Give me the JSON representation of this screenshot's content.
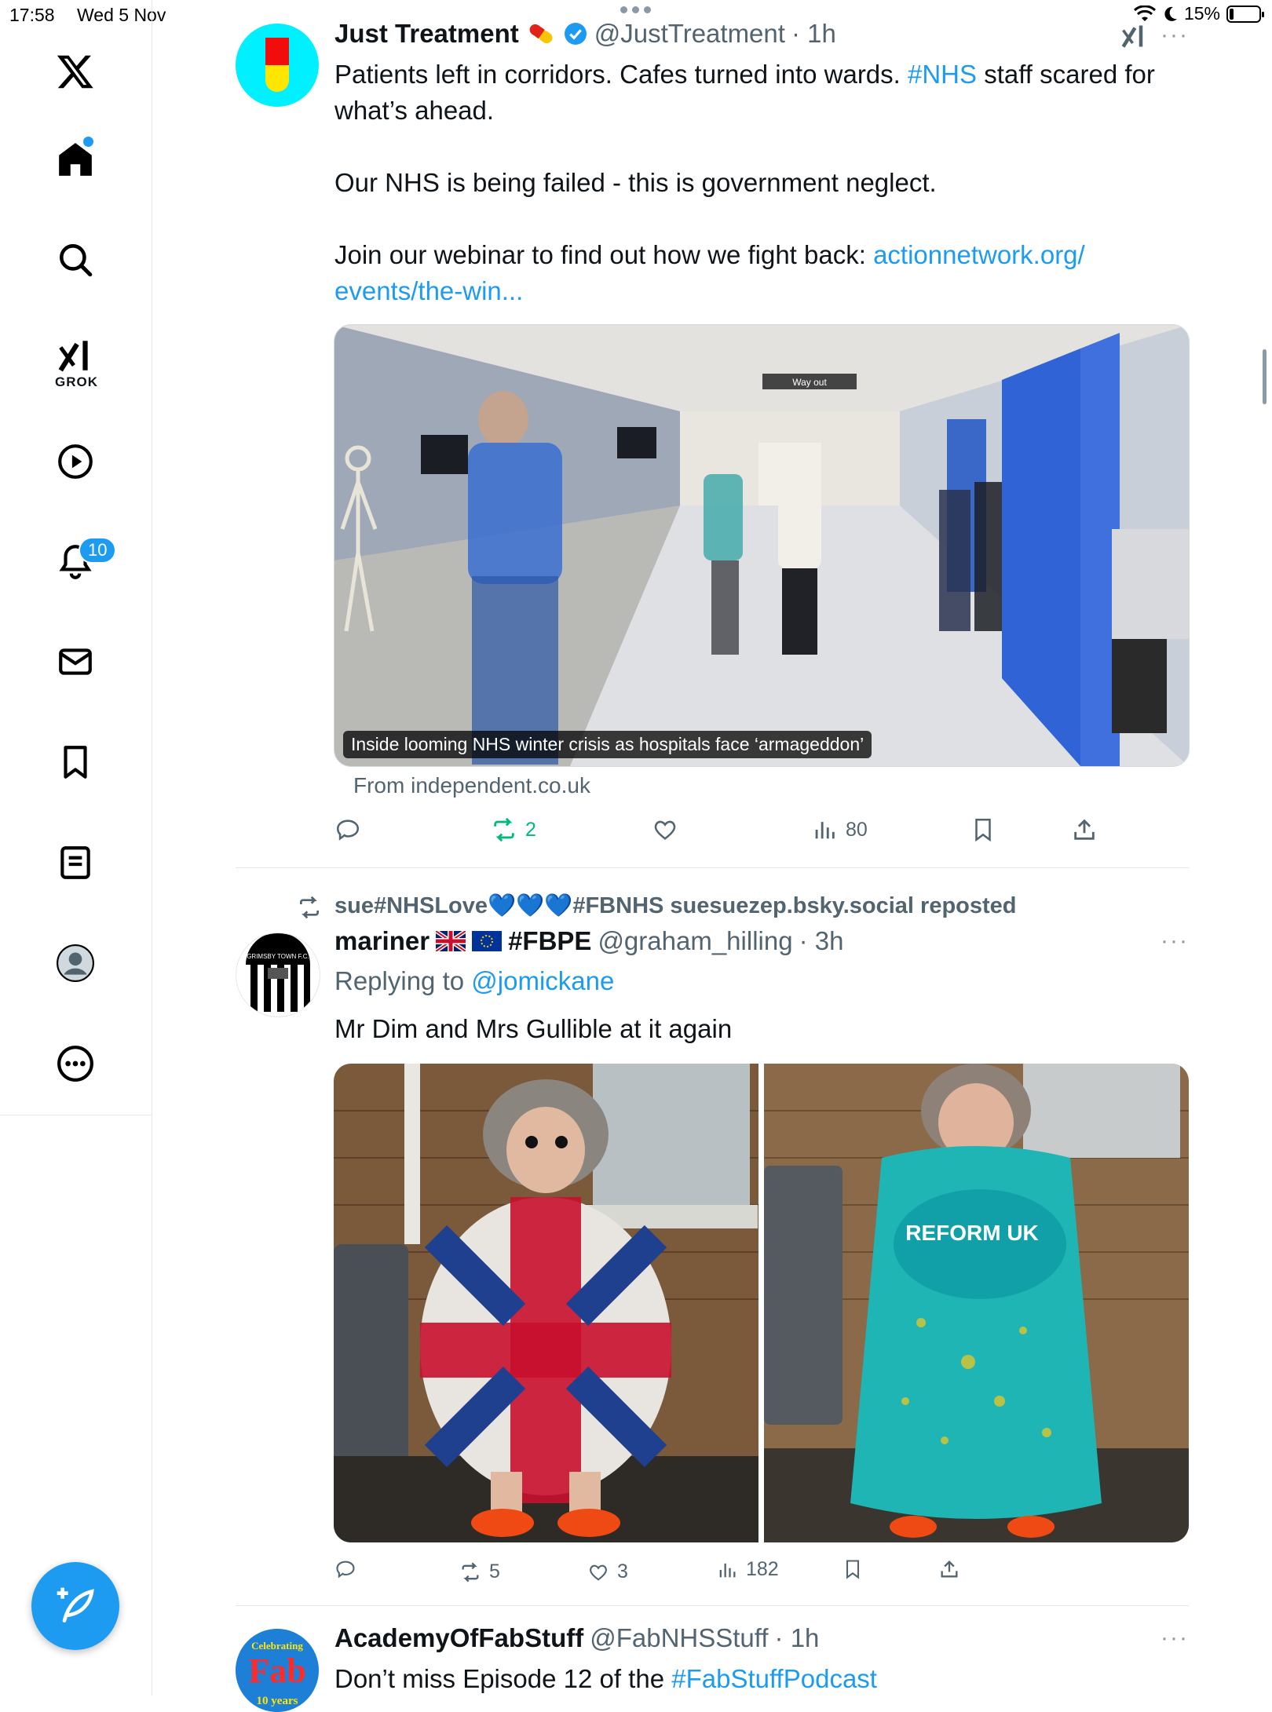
{
  "status_bar": {
    "time": "17:58",
    "date": "Wed 5 Nov",
    "battery": "15%",
    "battery_level": 0.15
  },
  "sidebar": {
    "grok_label": "GROK",
    "notifications_count": "10"
  },
  "tweet1": {
    "name": "Just Treatment",
    "handle": "@JustTreatment",
    "time": "· 1h",
    "text_part1": "Patients left in corridors. Cafes turned into wards. ",
    "hashtag": "#NHS",
    "text_part2": " staff scared for what’s ahead.",
    "text_para2": "Our NHS is being failed - this is government neglect.",
    "text_para3": "Join our webinar to find out how we fight back: ",
    "link": "actionnetwork.org/ events/the-win...",
    "card_caption": "Inside looming NHS winter crisis as hospitals face ‘armageddon’",
    "card_source": "From independent.co.uk",
    "sign_text": "Way out",
    "retweets": "2",
    "views": "80"
  },
  "tweet2": {
    "repost_by": "sue#NHSLove💙💙💙#FBNHS suesuezep.bsky.social reposted",
    "name": "mariner",
    "name_suffix": "#FBPE",
    "handle": "@graham_hilling",
    "time": "· 3h",
    "replying_prefix": "Replying to ",
    "replying_to": "@jomickane",
    "text": "Mr Dim and Mrs Gullible at it again",
    "shirt_text": "REFORM UK",
    "avatar_text": "GRIMSBY TOWN F.C.",
    "retweets": "5",
    "likes": "3",
    "views": "182"
  },
  "tweet3": {
    "name": "AcademyOfFabStuff",
    "handle": "@FabNHSStuff",
    "time": "· 1h",
    "text_prefix": "Don’t miss Episode 12 of the ",
    "hashtag": "#FabStuffPodcast",
    "avatar_text_top": "Celebrating",
    "avatar_text_mid": "Fab",
    "avatar_text_bottom": "10 years"
  }
}
